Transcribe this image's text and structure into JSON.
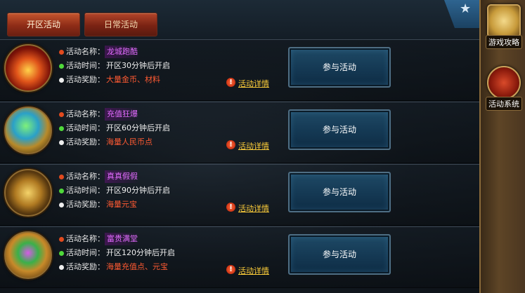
{
  "tabs": [
    {
      "label": "开区活动",
      "active": true
    },
    {
      "label": "日常活动",
      "active": false
    }
  ],
  "sidebar": {
    "items": [
      {
        "label": "游戏攻略",
        "icon": "scroll-icon"
      },
      {
        "label": "活动系统",
        "icon": "drum-icon"
      }
    ]
  },
  "field_labels": {
    "name": "活动名称：",
    "time": "活动时间：",
    "reward": "活动奖励："
  },
  "activities": [
    {
      "name": "龙城跑酷",
      "time": "开区30分钟后开启",
      "reward": "大量金币、材料",
      "button": "参与活动",
      "detail": "活动详情",
      "icon": "book-icon"
    },
    {
      "name": "充值狂爆",
      "time": "开区60分钟后开启",
      "reward": "海量人民币点",
      "button": "参与活动",
      "detail": "活动详情",
      "icon": "gem-pile-icon"
    },
    {
      "name": "真真假假",
      "time": "开区90分钟后开启",
      "reward": "海量元宝",
      "button": "参与活动",
      "detail": "活动详情",
      "icon": "treasure-chest-icon"
    },
    {
      "name": "富贵满堂",
      "time": "开区120分钟后开启",
      "reward": "海量充值点、元宝",
      "button": "参与活动",
      "detail": "活动详情",
      "icon": "treasure-bowl-icon"
    }
  ],
  "colors": {
    "tab": "#8e2c17",
    "name_text": "#e36bff",
    "reward_text": "#ff5a32",
    "detail_link": "#ffcf3a",
    "button": "#153a55"
  }
}
